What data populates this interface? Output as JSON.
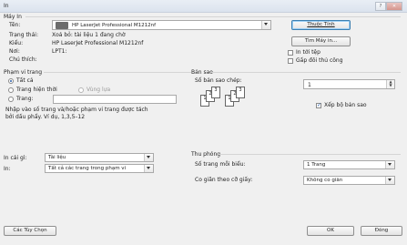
{
  "window": {
    "title": "In",
    "buttons": [
      "?",
      "✕"
    ]
  },
  "printer": {
    "group_label": "Máy In",
    "name_label": "Tên:",
    "name_value": "HP LaserJet Professional M1212nf",
    "status_label": "Trạng thái:",
    "status_value": "Xoá bỏ: tài liệu 1 đang chờ",
    "type_label": "Kiểu:",
    "type_value": "HP LaserJet Professional M1212nf",
    "where_label": "Nơi:",
    "where_value": "LPT1:",
    "comment_label": "Chú thích:",
    "comment_value": "",
    "properties_button": "Thuộc Tính",
    "find_printer_button": "Tìm Máy in...",
    "print_to_file_label": "In tới tệp",
    "manual_duplex_label": "Gấp đôi thủ công"
  },
  "page_range": {
    "group_label": "Phạm vi trang",
    "all_label": "Tất cả",
    "current_page_label": "Trang hiện thời",
    "selection_label": "Vùng lựa",
    "pages_label": "Trang:",
    "pages_value": "",
    "hint_line1": "Nhập vào số trang và/hoặc phạm vi trang được tách",
    "hint_line2": "bởi dấu phẩy.  Ví dụ, 1,3,5–12"
  },
  "copies": {
    "group_label": "Bản sao",
    "count_label": "Số bản sao chép:",
    "count_value": "1",
    "collate_label": "Xếp bộ bản sao",
    "collate_checked": true,
    "doc_numbers": [
      "1",
      "2",
      "3"
    ]
  },
  "print_what": {
    "label": "In cái gì:",
    "value": "Tài liệu",
    "print_label": "In:",
    "print_value": "Tất cả các trang trong phạm vi"
  },
  "zoom": {
    "group_label": "Thu phóng",
    "pages_per_sheet_label": "Số trang mỗi biểu:",
    "pages_per_sheet_value": "1 Trang",
    "scale_label": "Co giãn theo cỡ giấy:",
    "scale_value": "Không co giãn"
  },
  "footer": {
    "options_button": "Các Tùy Chọn",
    "ok_button": "OK",
    "close_button": "Đóng"
  },
  "icons": {
    "printer": "printer-icon",
    "help": "help-icon",
    "close": "close-icon"
  }
}
